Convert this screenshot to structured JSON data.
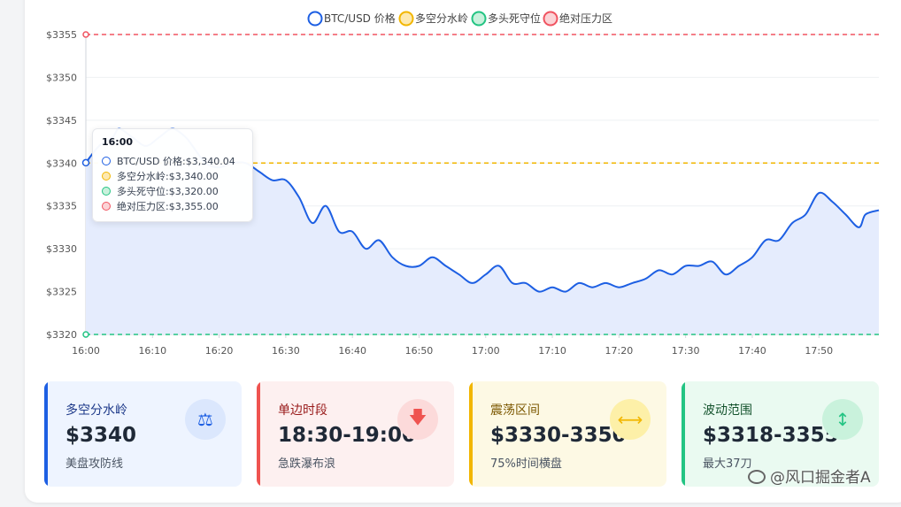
{
  "chart_data": {
    "type": "line",
    "x_labels": [
      "16:00",
      "16:10",
      "16:20",
      "16:30",
      "16:40",
      "16:50",
      "17:00",
      "17:10",
      "17:20",
      "17:30",
      "17:40",
      "17:50"
    ],
    "y_ticks": [
      3320,
      3325,
      3330,
      3335,
      3340,
      3345,
      3350,
      3355
    ],
    "ylim": [
      3320,
      3355
    ],
    "legend_position": "top-center",
    "series": [
      {
        "name": "BTC/USD 价格",
        "color": "#1d5fe3",
        "style": "line-area",
        "x_minutes_from_16_00": [
          0,
          2,
          4,
          5,
          7,
          9,
          11,
          13,
          15,
          16,
          18,
          20,
          22,
          24,
          26,
          28,
          30,
          32,
          34,
          36,
          38,
          40,
          42,
          44,
          46,
          48,
          50,
          52,
          54,
          56,
          58,
          60,
          62,
          64,
          66,
          68,
          70,
          72,
          74,
          76,
          78,
          80,
          82,
          84,
          86,
          88,
          90,
          92,
          94,
          96,
          98,
          100,
          102,
          104,
          106,
          108,
          110,
          112,
          114,
          116,
          117,
          119
        ],
        "values": [
          3340.04,
          3342,
          3343,
          3344,
          3343,
          3342,
          3343,
          3344,
          3343,
          3342,
          3340,
          3339.5,
          3340,
          3340,
          3339,
          3338,
          3338,
          3336,
          3333,
          3335,
          3332,
          3332,
          3330,
          3331,
          3329,
          3328,
          3328,
          3329,
          3328,
          3327,
          3326,
          3327,
          3328,
          3326,
          3326,
          3325,
          3325.5,
          3325,
          3326,
          3325.5,
          3326,
          3325.5,
          3326,
          3326.5,
          3327.5,
          3327,
          3328,
          3328,
          3328.5,
          3327,
          3328,
          3329,
          3331,
          3331,
          3333,
          3334,
          3336.5,
          3335.5,
          3334,
          3332.5,
          3334,
          3334.5
        ]
      },
      {
        "name": "多空分水岭",
        "color": "#f2b600",
        "style": "dashed",
        "values": [
          3340,
          3340
        ]
      },
      {
        "name": "多头死守位",
        "color": "#23c483",
        "style": "dashed",
        "values": [
          3320,
          3320
        ]
      },
      {
        "name": "绝对压力区",
        "color": "#f05360",
        "style": "dashed",
        "values": [
          3355,
          3355
        ]
      }
    ],
    "tooltip": {
      "time": "16:00",
      "rows": [
        {
          "label": "BTC/USD 价格",
          "value": "$3,340.04",
          "color": "#1d5fe3",
          "fill": "#ffffff"
        },
        {
          "label": "多空分水岭",
          "value": "$3,340.00",
          "color": "#f2b600",
          "fill": "#fde9b0"
        },
        {
          "label": "多头死守位",
          "value": "$3,320.00",
          "color": "#23c483",
          "fill": "#c8f1dc"
        },
        {
          "label": "绝对压力区",
          "value": "$3,355.00",
          "color": "#f05360",
          "fill": "#fbd3d6"
        }
      ]
    }
  },
  "cards": [
    {
      "title": "多空分水岭",
      "value": "$3340",
      "sub": "美盘攻防线",
      "icon": "scale-icon",
      "glyph": "⚖",
      "accent": "#1d5fe3",
      "bg": "#eef4ff",
      "icon_bg": "#dbe7fd",
      "title_color": "#1e3a8a"
    },
    {
      "title": "单边时段",
      "value": "18:30-19:00",
      "sub": "急跌瀑布浪",
      "icon": "arrow-down-icon",
      "glyph": "🡇",
      "accent": "#ef5350",
      "bg": "#fdf0f0",
      "icon_bg": "#fcdada",
      "title_color": "#991b1b"
    },
    {
      "title": "震荡区间",
      "value": "$3330-3350",
      "sub": "75%时间横盘",
      "icon": "arrows-horizontal-icon",
      "glyph": "⟷",
      "accent": "#f2b600",
      "bg": "#fdf9e4",
      "icon_bg": "#fdf0a8",
      "title_color": "#7c5800"
    },
    {
      "title": "波动范围",
      "value": "$3318-3355",
      "sub": "最大37刀",
      "icon": "arrows-vertical-icon",
      "glyph": "↕",
      "accent": "#23c483",
      "bg": "#eafaf1",
      "icon_bg": "#c9f2dc",
      "title_color": "#14532d"
    }
  ],
  "watermark": {
    "text": "@风口掘金者A",
    "icon": "wechat-icon"
  }
}
